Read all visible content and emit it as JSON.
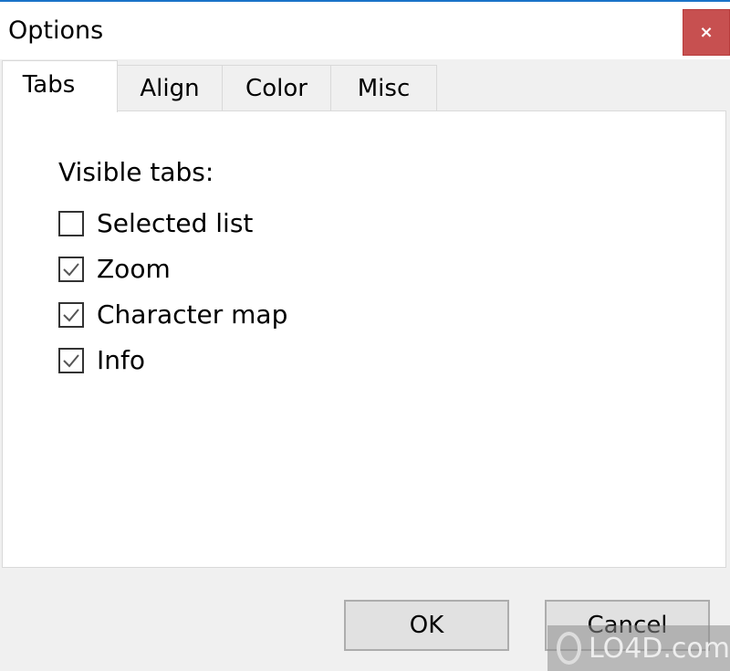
{
  "window": {
    "title": "Options",
    "close_label": "×"
  },
  "tabs": [
    {
      "label": "Tabs",
      "active": true
    },
    {
      "label": "Align",
      "active": false
    },
    {
      "label": "Color",
      "active": false
    },
    {
      "label": "Misc",
      "active": false
    }
  ],
  "panel": {
    "section_label": "Visible tabs:",
    "checkboxes": [
      {
        "label": "Selected list",
        "checked": false
      },
      {
        "label": "Zoom",
        "checked": true
      },
      {
        "label": "Character map",
        "checked": true
      },
      {
        "label": "Info",
        "checked": true
      }
    ]
  },
  "buttons": {
    "ok": "OK",
    "cancel": "Cancel"
  },
  "watermark": {
    "text": "LO4D.com"
  }
}
